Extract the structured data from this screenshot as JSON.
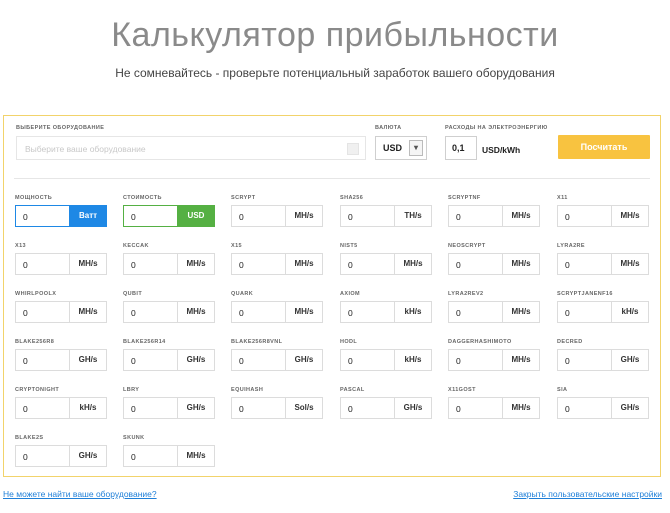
{
  "header": {
    "title": "Калькулятор прибыльности",
    "subtitle": "Не сомневайтесь - проверьте потенциальный заработок вашего оборудования"
  },
  "top": {
    "equipment_label": "Выберите оборудование",
    "equipment_placeholder": "Выберите ваше оборудование",
    "currency_label": "Валюта",
    "currency_value": "USD",
    "power_cost_label": "Расходы на электроэнергию",
    "power_cost_value": "0,1",
    "power_cost_unit": "USD/kWh",
    "calc_button": "Посчитать"
  },
  "colors": {
    "accent": "#f8c340",
    "blue": "#1e88e5",
    "green": "#55b043",
    "border": "#f2d36b"
  },
  "fields": [
    {
      "label": "Мощность",
      "value": "0",
      "unit": "Ватт",
      "style": "blue"
    },
    {
      "label": "Стоимость",
      "value": "0",
      "unit": "USD",
      "style": "green"
    },
    {
      "label": "Scrypt",
      "value": "0",
      "unit": "MH/s"
    },
    {
      "label": "SHA256",
      "value": "0",
      "unit": "TH/s"
    },
    {
      "label": "ScryptNf",
      "value": "0",
      "unit": "MH/s"
    },
    {
      "label": "X11",
      "value": "0",
      "unit": "MH/s"
    },
    {
      "label": "X13",
      "value": "0",
      "unit": "MH/s"
    },
    {
      "label": "Keccak",
      "value": "0",
      "unit": "MH/s"
    },
    {
      "label": "X15",
      "value": "0",
      "unit": "MH/s"
    },
    {
      "label": "NIST5",
      "value": "0",
      "unit": "MH/s"
    },
    {
      "label": "NeoScrypt",
      "value": "0",
      "unit": "MH/s"
    },
    {
      "label": "Lyra2RE",
      "value": "0",
      "unit": "MH/s"
    },
    {
      "label": "WhirlpoolX",
      "value": "0",
      "unit": "MH/s"
    },
    {
      "label": "Qubit",
      "value": "0",
      "unit": "MH/s"
    },
    {
      "label": "Quark",
      "value": "0",
      "unit": "MH/s"
    },
    {
      "label": "Axiom",
      "value": "0",
      "unit": "kH/s"
    },
    {
      "label": "Lyra2REv2",
      "value": "0",
      "unit": "MH/s"
    },
    {
      "label": "ScryptJaneNf16",
      "value": "0",
      "unit": "kH/s"
    },
    {
      "label": "Blake256R8",
      "value": "0",
      "unit": "GH/s"
    },
    {
      "label": "Blake256R14",
      "value": "0",
      "unit": "GH/s"
    },
    {
      "label": "Blake256R8vnl",
      "value": "0",
      "unit": "GH/s"
    },
    {
      "label": "Hodl",
      "value": "0",
      "unit": "kH/s"
    },
    {
      "label": "DaggerHashimoto",
      "value": "0",
      "unit": "MH/s"
    },
    {
      "label": "Decred",
      "value": "0",
      "unit": "GH/s"
    },
    {
      "label": "CryptoNight",
      "value": "0",
      "unit": "kH/s"
    },
    {
      "label": "LBRY",
      "value": "0",
      "unit": "GH/s"
    },
    {
      "label": "Equihash",
      "value": "0",
      "unit": "Sol/s"
    },
    {
      "label": "Pascal",
      "value": "0",
      "unit": "GH/s"
    },
    {
      "label": "X11Gost",
      "value": "0",
      "unit": "MH/s"
    },
    {
      "label": "Sia",
      "value": "0",
      "unit": "GH/s"
    },
    {
      "label": "Blake2s",
      "value": "0",
      "unit": "GH/s"
    },
    {
      "label": "Skunk",
      "value": "0",
      "unit": "MH/s"
    }
  ],
  "footer": {
    "not_found_link": "Не можете найти ваше оборудование?",
    "close_settings_link": "Закрыть пользовательские настройки"
  }
}
